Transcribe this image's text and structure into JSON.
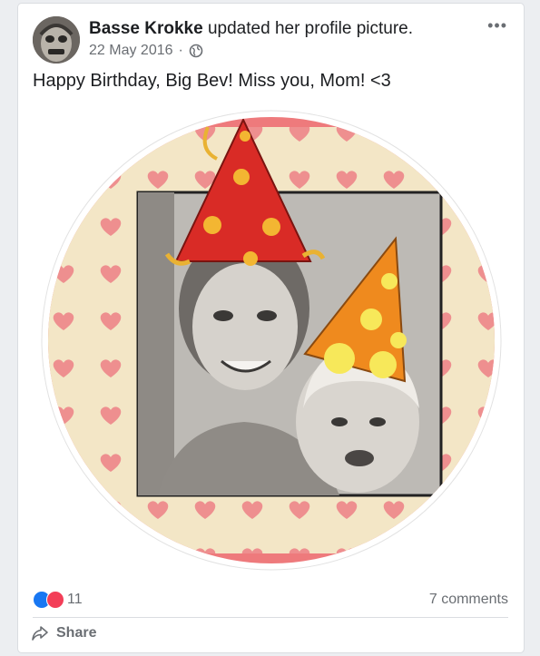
{
  "post": {
    "author": "Basse Krokke",
    "action": " updated her profile picture.",
    "date": "22 May 2016",
    "separator": "·",
    "privacy_icon": "globe-icon",
    "more_icon": "ellipsis-icon",
    "more_label": "•••",
    "caption": "Happy Birthday, Big Bev! Miss you, Mom! <3"
  },
  "stats": {
    "reaction_icons": [
      "like-icon",
      "love-icon"
    ],
    "reaction_count": "11",
    "comments": "7 comments"
  },
  "actions": {
    "share_label": "Share",
    "share_icon": "share-arrow-icon"
  },
  "colors": {
    "like": "#1877f2",
    "love": "#f33e58",
    "frame_pink": "#ee7a7c",
    "frame_cream": "#f3e6c6"
  }
}
